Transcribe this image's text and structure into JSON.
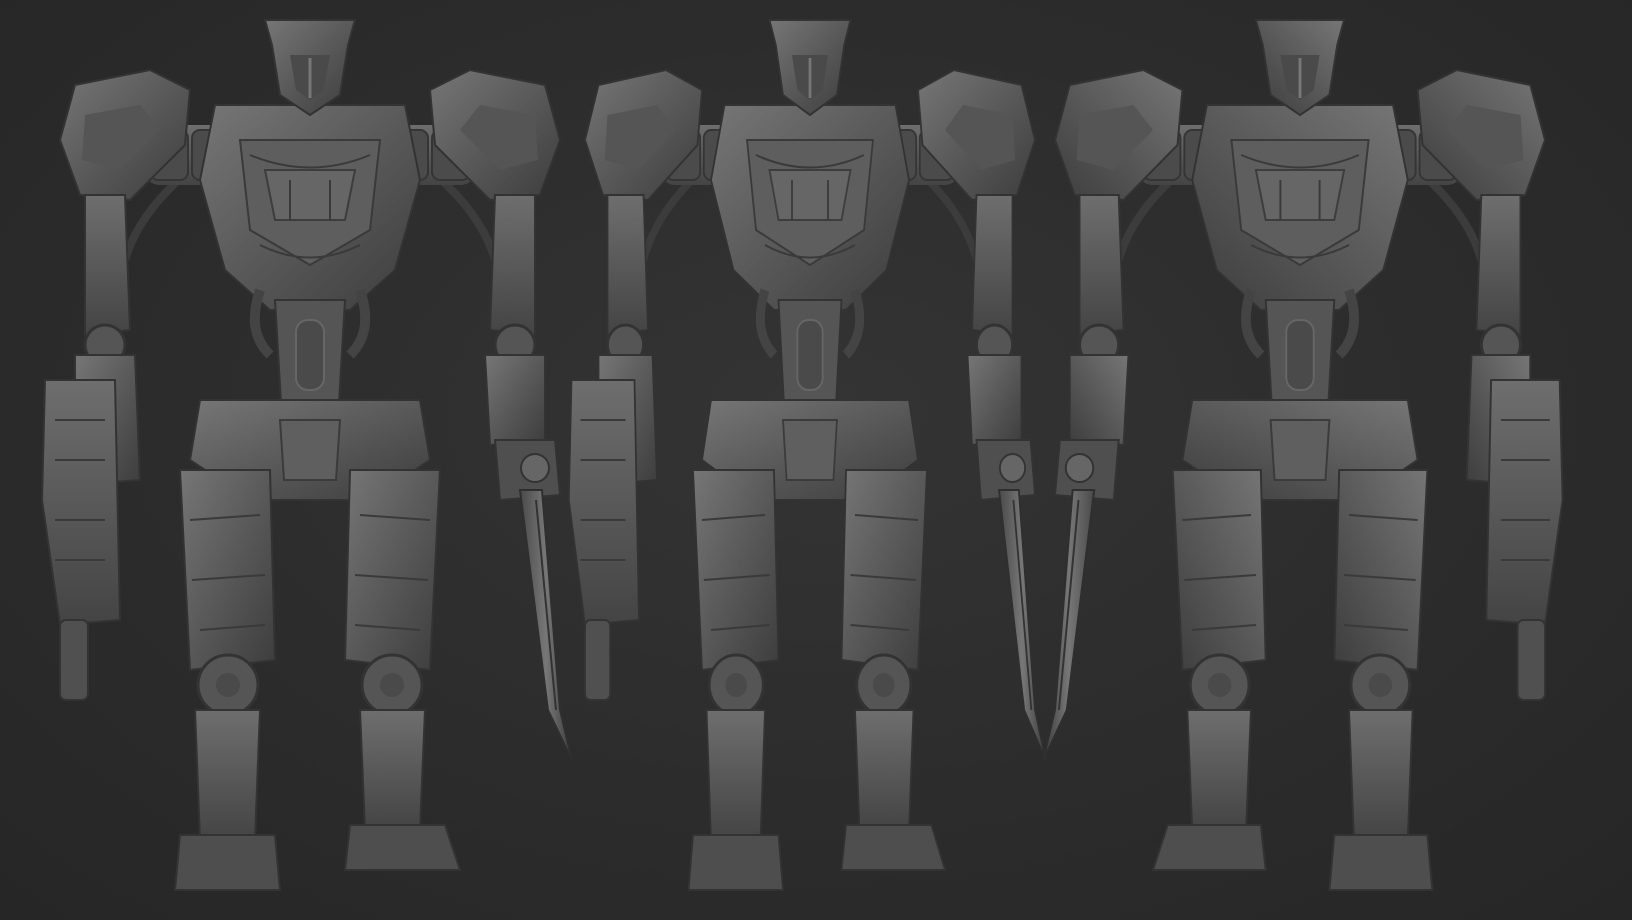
{
  "scene": {
    "subject": "three-views-of-sculpted-mech-robot",
    "views": [
      "front-view",
      "three-quarter-view",
      "back-view"
    ],
    "colors": {
      "background": "#2d2d2d",
      "material_base": "#5a5a5a",
      "material_shadow": "#3a3a3a",
      "material_highlight": "#7a7a7a",
      "panel_line": "#2a2a2a"
    }
  }
}
